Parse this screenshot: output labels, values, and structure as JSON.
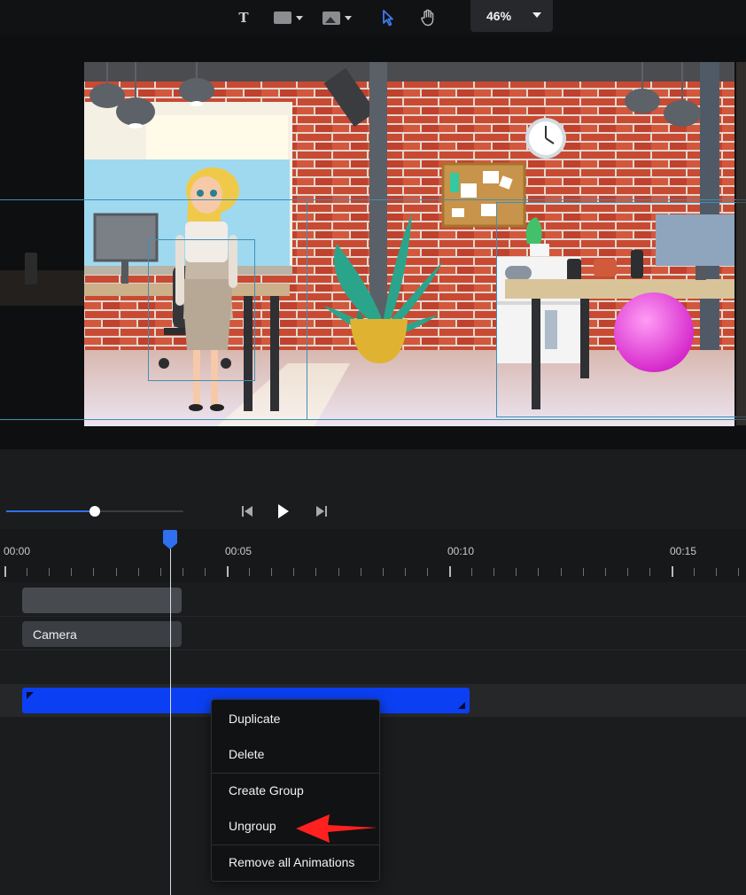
{
  "toolbar": {
    "text_tool_glyph": "T",
    "zoom_value": "46%",
    "tools": [
      {
        "name": "text-tool",
        "icon": "text-icon"
      },
      {
        "name": "shape-tool",
        "icon": "rectangle-icon"
      },
      {
        "name": "image-tool",
        "icon": "image-icon"
      },
      {
        "name": "select-tool",
        "icon": "cursor-arrow-icon",
        "active": true
      },
      {
        "name": "pan-tool",
        "icon": "hand-icon"
      }
    ],
    "accent_color": "#2f6ff0"
  },
  "playback": {
    "volume_level": 0.5,
    "buttons": [
      "skip-back-icon",
      "play-icon",
      "skip-forward-icon"
    ]
  },
  "timeline": {
    "ruler_labels": [
      "00:00",
      "00:05",
      "00:10",
      "00:15"
    ],
    "playhead_time_seconds": 3.7,
    "tracks": [
      {
        "label": ""
      },
      {
        "label": "Camera"
      }
    ],
    "selected_clip_color": "#0b3ff3"
  },
  "context_menu": {
    "items": [
      {
        "label": "Duplicate"
      },
      {
        "label": "Delete"
      },
      {
        "label": "Create Group"
      },
      {
        "label": "Ungroup"
      },
      {
        "label": "Remove all Animations"
      }
    ]
  },
  "annotation": {
    "arrow_color": "#ff2020"
  }
}
